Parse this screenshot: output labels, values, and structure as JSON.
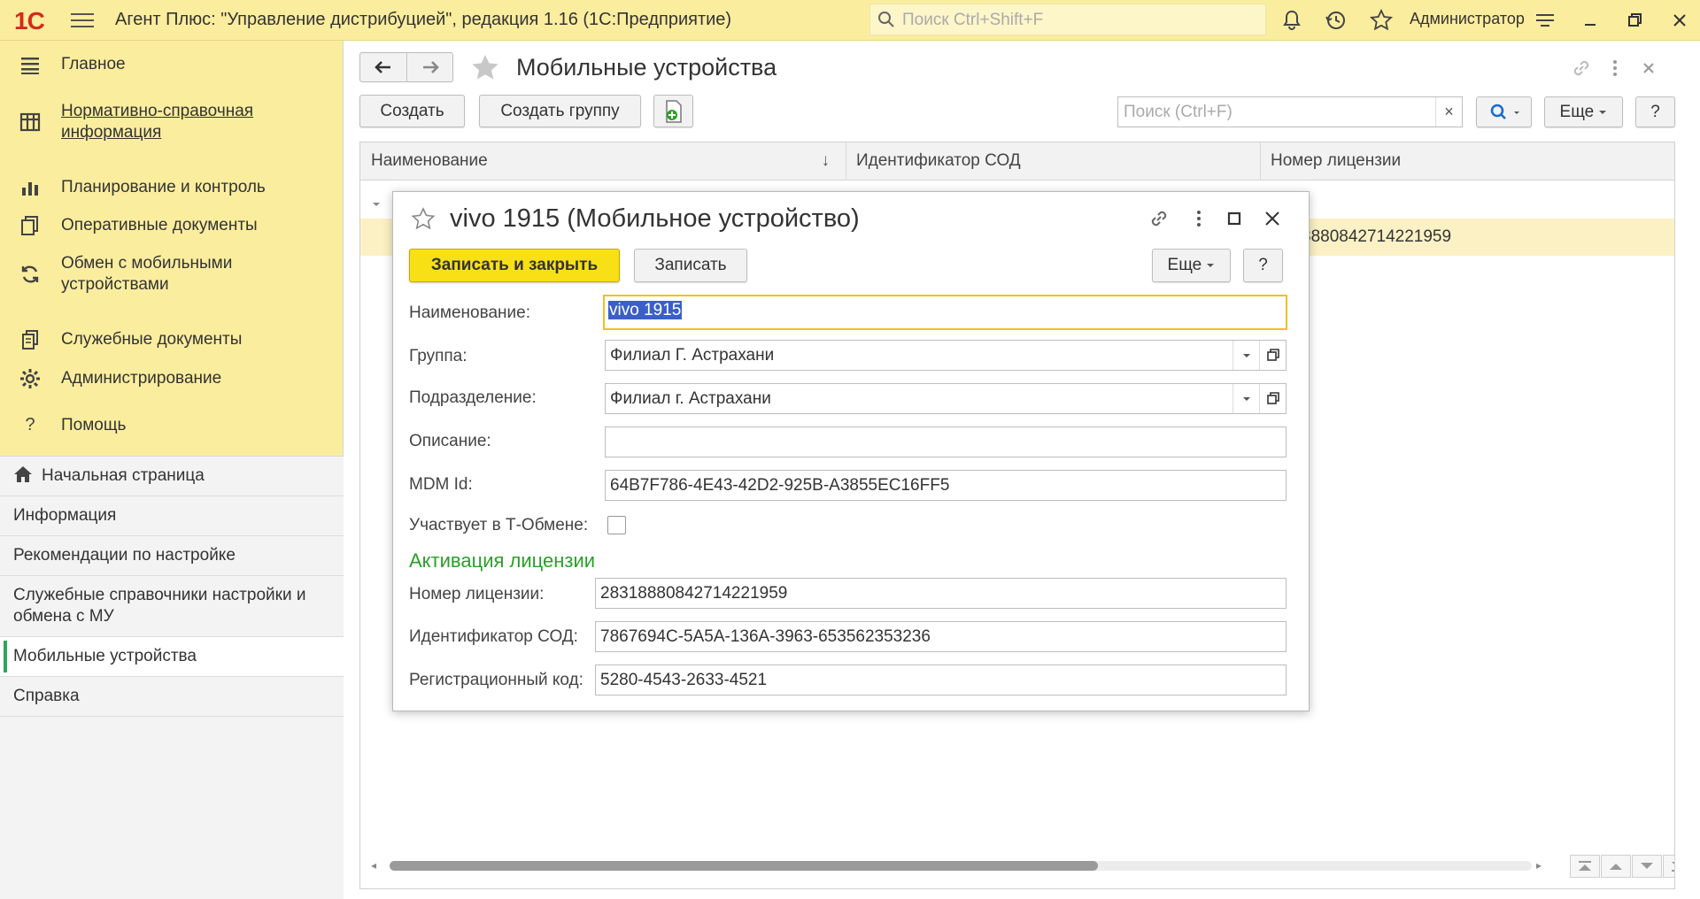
{
  "topbar": {
    "logo": "1С",
    "title": "Агент Плюс: \"Управление дистрибуцией\", редакция 1.16  (1С:Предприятие)",
    "search_placeholder": "Поиск Ctrl+Shift+F",
    "user": "Администратор"
  },
  "sections": [
    {
      "label": "Главное",
      "icon": "menu-lines-icon"
    },
    {
      "label": "Нормативно-справочная информация",
      "icon": "table-icon"
    },
    {
      "label": "Планирование и контроль",
      "icon": "chart-bars-icon"
    },
    {
      "label": "Оперативные документы",
      "icon": "documents-icon"
    },
    {
      "label": "Обмен с мобильными устройствами",
      "icon": "refresh-icon"
    },
    {
      "label": "Служебные документы",
      "icon": "documents-stack-icon"
    },
    {
      "label": "Администрирование",
      "icon": "gear-icon"
    },
    {
      "label": "Помощь",
      "icon": "question-icon"
    }
  ],
  "nav": [
    {
      "label": "Начальная страница",
      "icon": "home-icon"
    },
    {
      "label": "Информация"
    },
    {
      "label": "Рекомендации по настройке"
    },
    {
      "label": "Служебные справочники настройки и обмена с МУ"
    },
    {
      "label": "Мобильные устройства",
      "active": true
    },
    {
      "label": "Справка"
    }
  ],
  "main": {
    "title": "Мобильные устройства",
    "create": "Создать",
    "create_group": "Создать группу",
    "search_placeholder": "Поиск (Ctrl+F)",
    "clear": "×",
    "more": "Еще",
    "help": "?",
    "columns": [
      "Наименование",
      "Идентификатор СОД",
      "Номер лицензии"
    ],
    "sort_indicator": "↓",
    "visible_cell": "8880842714221959"
  },
  "dialog": {
    "title": "vivo 1915 (Мобильное устройство)",
    "save_close": "Записать и закрыть",
    "save": "Записать",
    "more": "Еще",
    "help": "?",
    "labels": {
      "name": "Наименование:",
      "group": "Группа:",
      "division": "Подразделение:",
      "description": "Описание:",
      "mdm": "MDM Id:",
      "tobmen": "Участвует в Т-Обмене:",
      "license_number": "Номер лицензии:",
      "sod_id": "Идентификатор СОД:",
      "reg_code": "Регистрационный код:"
    },
    "values": {
      "name": "vivo 1915",
      "group": "Филиал Г. Астрахани",
      "division": "Филиал г. Астрахани",
      "description": "",
      "mdm": "64B7F786-4E43-42D2-925B-A3855EC16FF5",
      "tobmen_checked": false,
      "license_number": "28318880842714221959",
      "sod_id": "7867694C-5A5A-136A-3963-653562353236",
      "reg_code": "5280-4543-2633-4521"
    },
    "section_title": "Активация лицензии"
  },
  "colors": {
    "topbar": "#fbed9e",
    "primary_button": "#f8e016",
    "section_green": "#2aa02a",
    "active_marker": "#2aa65c",
    "selected_row": "#fbf1c4"
  }
}
